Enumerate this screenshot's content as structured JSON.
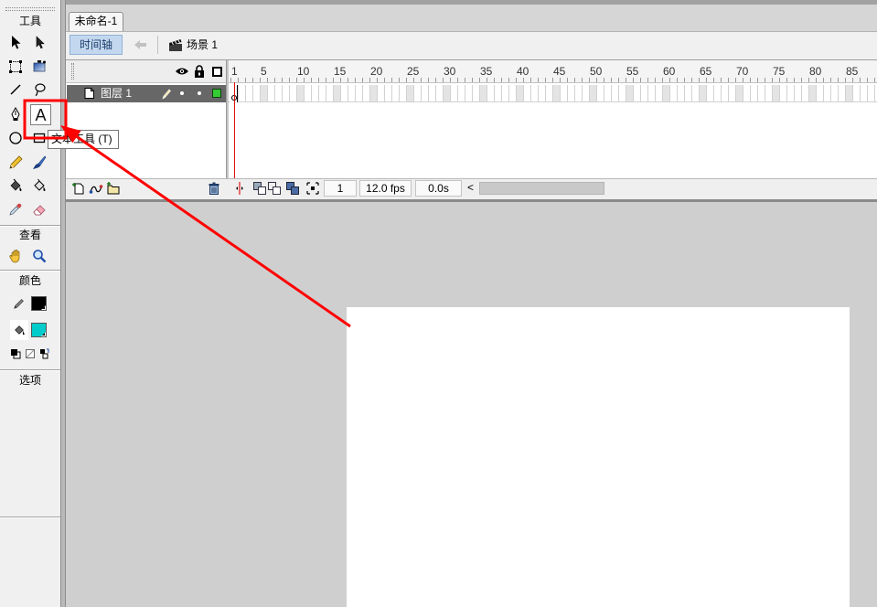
{
  "window": {
    "document_tab": "未命名-1",
    "timeline_button": "时间轴",
    "scene_label": "场景 1"
  },
  "tools_panel": {
    "title": "工具",
    "view_label": "查看",
    "color_label": "颜色",
    "options_label": "选项",
    "selected_tool": "text-tool",
    "text_tool_glyph": "A",
    "tooltip": "文本工具 (T)",
    "stroke_color": "#000000",
    "fill_color": "#00cccc"
  },
  "timeline": {
    "frame_ruler": [
      1,
      5,
      10,
      15,
      20,
      25,
      30,
      35,
      40,
      45,
      50,
      55,
      60,
      65,
      70,
      75,
      80,
      85
    ],
    "playhead_frame": 1,
    "layers": [
      {
        "name": "图层 1",
        "selected": true,
        "outline_color": "#33cc33"
      }
    ],
    "current_frame": "1",
    "frame_rate": "12.0 fps",
    "elapsed_time": "0.0s",
    "scroll_left_glyph": "<"
  },
  "colors": {
    "annotation": "#ff0000",
    "workspace": "#cfcfcf",
    "stage": "#ffffff"
  }
}
